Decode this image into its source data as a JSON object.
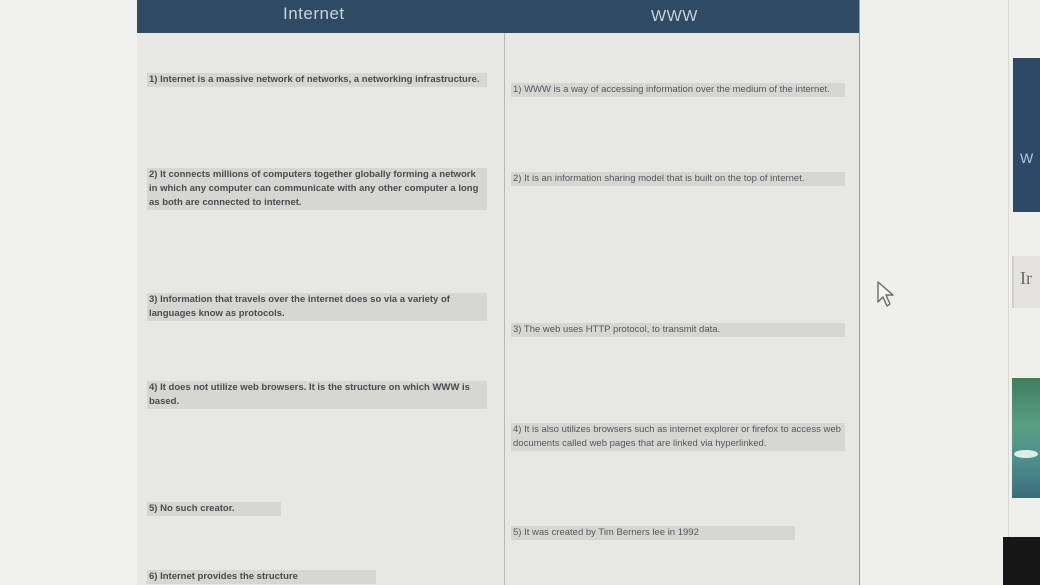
{
  "table": {
    "headers": {
      "internet": "Internet",
      "www": "WWW"
    },
    "internet_points": [
      "1) Internet is a massive network of networks, a networking infrastructure.",
      "2) It connects millions of computers together globally forming a network in which any computer can communicate with any other computer a long as both are connected to internet.",
      "3) Information that travels over the internet does so via a variety of languages know as protocols.",
      "4) It does not utilize web browsers. It is the structure on which WWW is based.",
      "5) No such creator.",
      "6) Internet provides the structure"
    ],
    "www_points": [
      "1) WWW is a way of accessing information over the medium of the internet.",
      "2) It is an information sharing model that is built on the top of internet.",
      "3) The web uses HTTP protocol, to transmit data.",
      "4) It is also utilizes browsers such as internet explorer or firefox to access web documents called web pages that are linked via hyperlinked.",
      "5) It was created by Tim Berners lee in 1992"
    ]
  },
  "side_thumbnails": {
    "top_label": "W",
    "mid_label": "Ir"
  },
  "icons": {
    "cursor": "arrow-cursor-icon"
  }
}
